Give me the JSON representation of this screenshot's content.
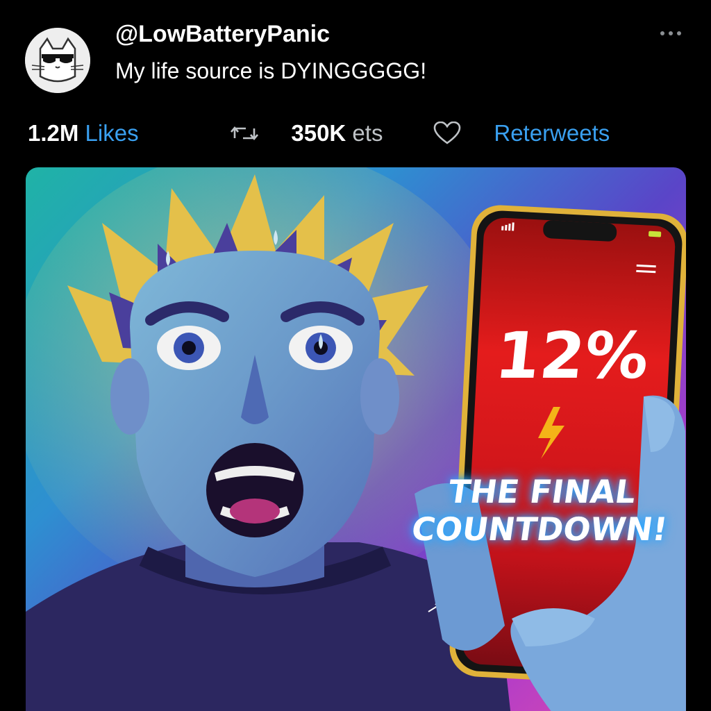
{
  "post": {
    "handle": "@LowBatteryPanic",
    "text": "My life source is DYINGGGGG!",
    "avatar_icon": "cat-sunglasses-icon",
    "menu_icon": "more-dots-icon"
  },
  "stats": {
    "likes_count": "1.2M",
    "likes_label": " Likes",
    "retweet_icon": "retweet-icon",
    "retweets_count": "350K",
    "retweets_label": " ets",
    "heart_icon": "heart-icon",
    "reterweets_label": "Reterweets"
  },
  "media": {
    "battery_percent": "12%",
    "bolt_icon": "lightning-bolt-icon",
    "caption_line1": "THE FINAL",
    "caption_line2": "COUNTDOWN!"
  },
  "colors": {
    "background": "#000000",
    "link_blue": "#3aa0f0",
    "phone_red": "#e21b1b"
  }
}
